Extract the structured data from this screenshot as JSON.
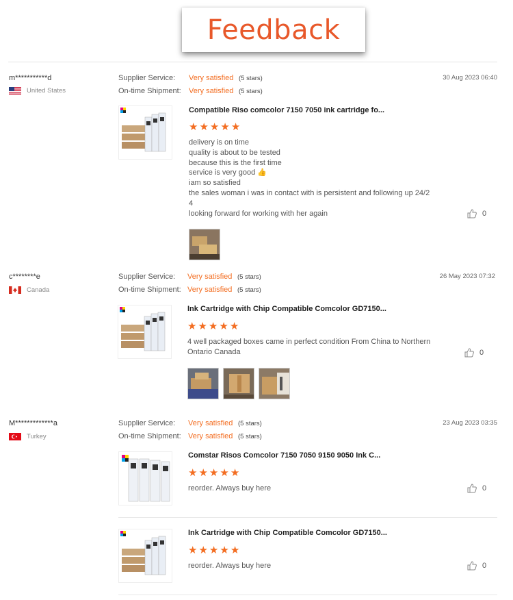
{
  "banner": {
    "title": "Feedback"
  },
  "labels": {
    "supplier": "Supplier Service:",
    "shipment": "On-time Shipment:"
  },
  "reviews": [
    {
      "user": "m***********d",
      "country": "United States",
      "date": "30 Aug 2023 06:40",
      "supplier": {
        "rating": "Very satisfied",
        "stars": "(5 stars)"
      },
      "shipment": {
        "rating": "Very satisfied",
        "stars": "(5 stars)"
      },
      "products": [
        {
          "title": "Compatible Riso comcolor 7150 7050 ink cartridge fo...",
          "rating": 5,
          "lines": [
            "delivery is on time",
            "quality is about to be tested",
            "because this is the first time",
            "service is very good 👍",
            "iam so satisfied",
            "the sales woman i was in contact with is persistent and following up 24/2",
            "4",
            "looking forward for working with her again"
          ],
          "likes": "0"
        }
      ]
    },
    {
      "user": "c********e",
      "country": "Canada",
      "date": "26 May 2023 07:32",
      "supplier": {
        "rating": "Very satisfied",
        "stars": "(5 stars)"
      },
      "shipment": {
        "rating": "Very satisfied",
        "stars": "(5 stars)"
      },
      "products": [
        {
          "title": "Ink Cartridge with Chip Compatible Comcolor GD7150...",
          "rating": 5,
          "lines": [
            "4 well packaged boxes came in perfect condition From China to Northern",
            "Ontario Canada"
          ],
          "likes": "0"
        }
      ]
    },
    {
      "user": "M*************a",
      "country": "Turkey",
      "date": "23 Aug 2023 03:35",
      "supplier": {
        "rating": "Very satisfied",
        "stars": "(5 stars)"
      },
      "shipment": {
        "rating": "Very satisfied",
        "stars": "(5 stars)"
      },
      "products": [
        {
          "title": "Comstar Risos Comcolor 7150 7050 9150 9050 Ink C...",
          "rating": 5,
          "lines": [
            "reorder. Always buy here"
          ],
          "likes": "0"
        },
        {
          "title": "Ink Cartridge with Chip Compatible Comcolor GD7150...",
          "rating": 5,
          "lines": [
            "reorder. Always buy here"
          ],
          "likes": "0"
        }
      ]
    }
  ]
}
